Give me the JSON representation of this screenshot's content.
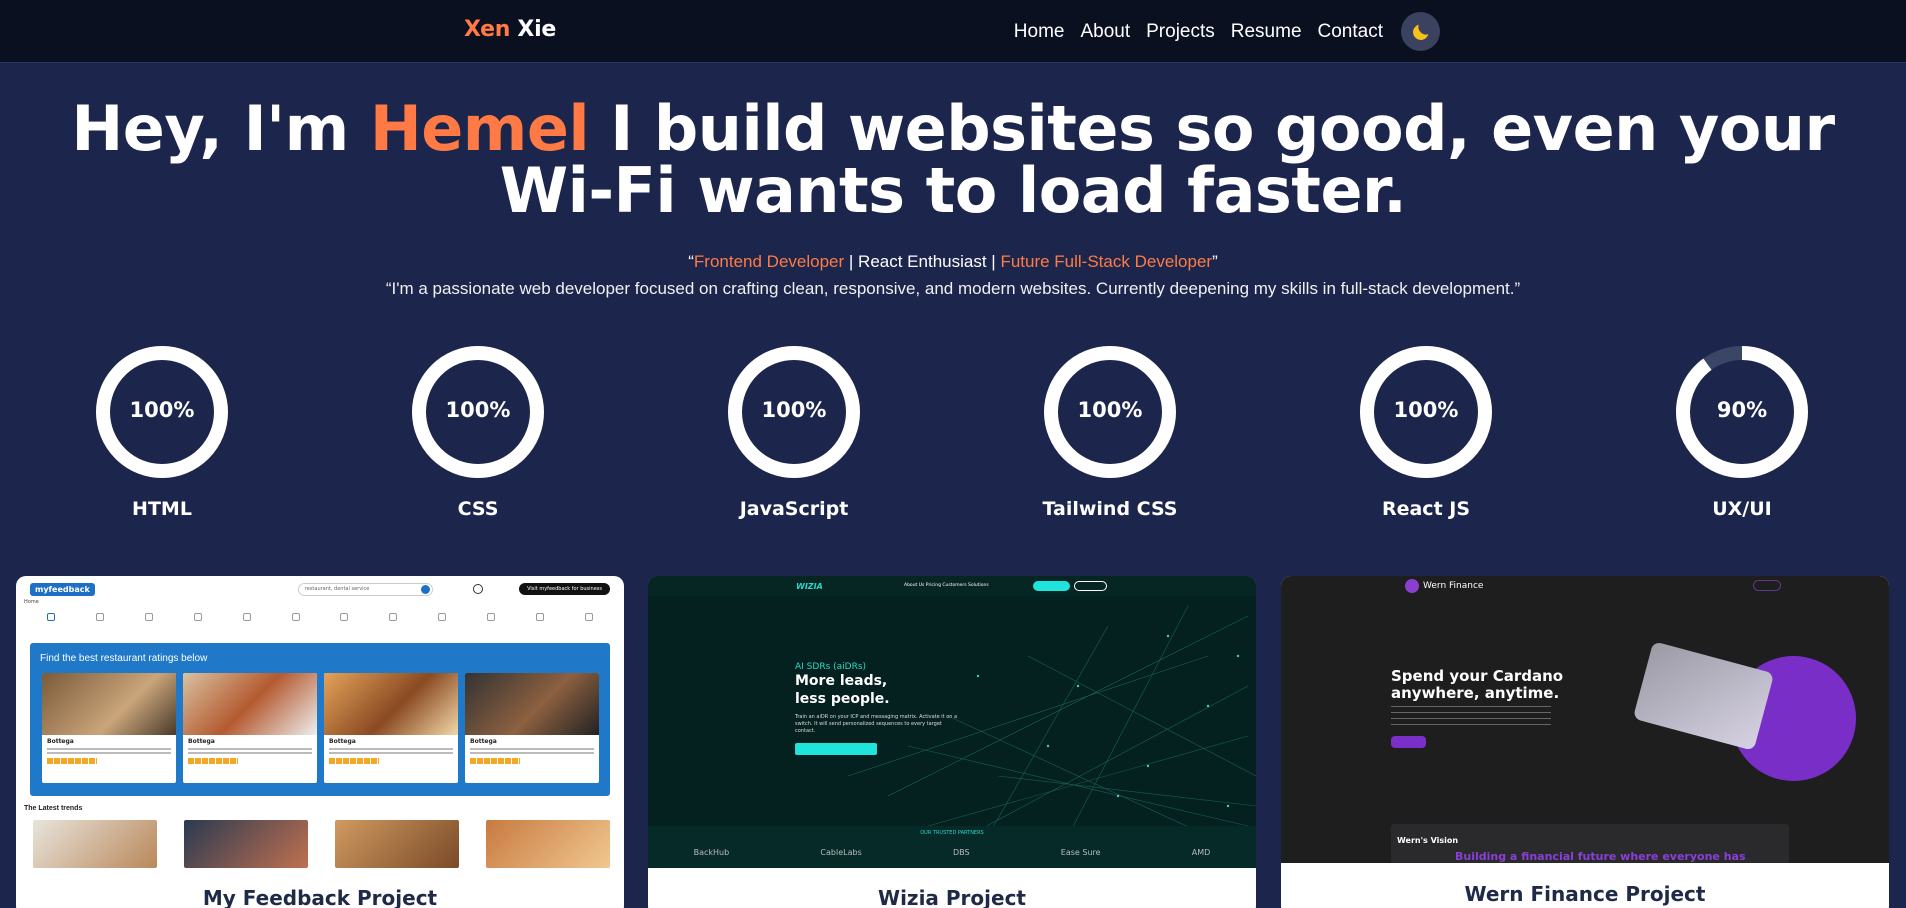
{
  "nav": {
    "logo_first": "Xen",
    "logo_last": "Xie",
    "links": [
      "Home",
      "About",
      "Projects",
      "Resume",
      "Contact"
    ],
    "theme_icon": "moon-icon"
  },
  "hero": {
    "title_pre": "Hey, I'm",
    "title_name": "Hemel",
    "title_post": "I build websites so good, even your Wi-Fi wants to load faster.",
    "tagline_open": "“",
    "tagline_role1": "Frontend Developer",
    "tagline_sep1": " | ",
    "tagline_role2": "React Enthusiast",
    "tagline_sep2": " | ",
    "tagline_role3": "Future Full-Stack Developer",
    "tagline_close": "”",
    "description": "“I'm a passionate web developer focused on crafting clean, responsive, and modern websites. Currently deepening my skills in full-stack development.”"
  },
  "skills": [
    {
      "name": "HTML",
      "percent": 100,
      "label": "100%"
    },
    {
      "name": "CSS",
      "percent": 100,
      "label": "100%"
    },
    {
      "name": "JavaScript",
      "percent": 100,
      "label": "100%"
    },
    {
      "name": "Tailwind CSS",
      "percent": 100,
      "label": "100%"
    },
    {
      "name": "React JS",
      "percent": 100,
      "label": "100%"
    },
    {
      "name": "UX/UI",
      "percent": 90,
      "label": "90%"
    }
  ],
  "projects": [
    {
      "title": "My Feedback Project",
      "preview": {
        "logo": "myfeedback",
        "search_placeholder": "restaurant, dental service",
        "business_button": "Visit myfeedback for business",
        "breadcrumb": "Home",
        "banner_title": "Find the best restaurant ratings below",
        "tile_name": "Bottega",
        "section_title": "The Latest trends"
      }
    },
    {
      "title": "Wizia Project",
      "preview": {
        "logo": "WIZIA",
        "nav_links": "About Us   Pricing   Customers   Solutions",
        "kicker": "AI SDRs (aiDRs)",
        "headline_1": "More leads,",
        "headline_2": "less people.",
        "body": "Train an aiDR on your ICP and messaging matrix. Activate it on a switch. It will send personalized sequences to every target contact.",
        "partners_title": "OUR TRUSTED PARTNERS",
        "partners": [
          "BackHub",
          "CableLabs",
          "DBS",
          "Ease Sure",
          "AMD"
        ]
      }
    },
    {
      "title": "Wern Finance Project",
      "preview": {
        "logo": "Wern Finance",
        "headline_1": "Spend your Cardano",
        "headline_2": "anywhere, anytime.",
        "vision_title": "Wern's Vision",
        "vision_text": "Building a financial future where everyone has"
      }
    }
  ],
  "colors": {
    "accent": "#ff7a45",
    "background": "#1c264c",
    "nav_background": "#0b1020"
  }
}
